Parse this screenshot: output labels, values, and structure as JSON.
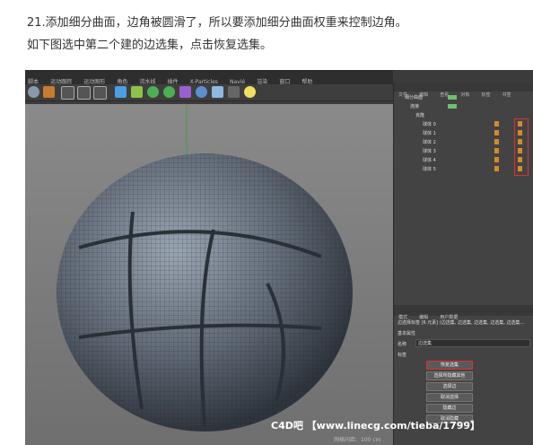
{
  "text": {
    "line1": "21.添加细分曲面，边角被圆滑了，所以要添加细分曲面权重来控制边角。",
    "line2": "如下图选中第二个建的边选集，点击恢复选集。"
  },
  "app": {
    "menu": [
      "脚本",
      "运动跟踪",
      "运动图形",
      "角色",
      "流水线",
      "插件",
      "X-Particles",
      "Navié",
      "渲染",
      "窗口",
      "帮助"
    ],
    "object_panel_menu": [
      "文件",
      "编辑",
      "查看",
      "对象",
      "标签",
      "书签"
    ],
    "objects": [
      {
        "name": "细分曲面"
      },
      {
        "name": "连接"
      },
      {
        "name": "克隆"
      },
      {
        "name": "球体 0"
      },
      {
        "name": "球体 1"
      },
      {
        "name": "球体 2"
      },
      {
        "name": "球体 3"
      },
      {
        "name": "球体 4"
      },
      {
        "name": "球体 5"
      }
    ],
    "attr_tabs": [
      "模式",
      "编辑",
      "用户数据"
    ],
    "attr_title": "边选择标签 [6 元素] (边选集, 边选集, 边选集, 边选集, 边选集...",
    "basic_props": "基本属性",
    "name_label": "名称",
    "name_value": "边选集",
    "tag_label": "标签",
    "buttons": [
      "恢复选集",
      "选择所隐藏其他",
      "选择边",
      "取消选择",
      "隐藏边",
      "取消隐藏"
    ],
    "highlighted_button": "恢复选集",
    "watermark": "C4D吧 【www.linecg.com/tieba/1799】",
    "grid_scale": "网格间距：100 cm"
  }
}
